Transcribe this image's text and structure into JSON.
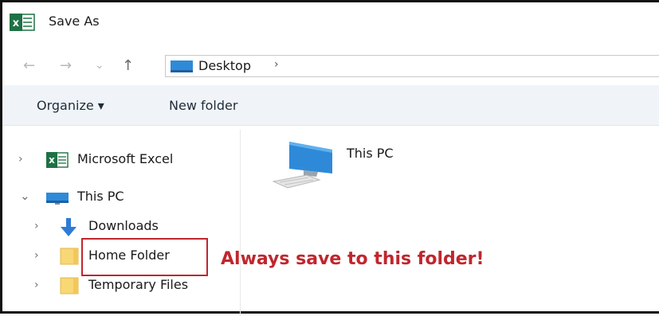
{
  "window": {
    "title": "Save As"
  },
  "navigation": {
    "back_glyph": "←",
    "forward_glyph": "→",
    "recent_glyph": "⌄",
    "up_glyph": "↑",
    "address_chevron": "›",
    "address_text": "Desktop"
  },
  "toolbar": {
    "organize_label": "Organize ▾",
    "new_folder_label": "New folder"
  },
  "sidebar": {
    "items": [
      {
        "label": "Microsoft Excel",
        "icon": "excel-icon",
        "expander": "›"
      },
      {
        "label": "This PC",
        "icon": "computer-icon",
        "expander": "⌄"
      },
      {
        "label": "Downloads",
        "icon": "downloads-arrow-icon",
        "expander": "›"
      },
      {
        "label": "Home Folder",
        "icon": "folder-icon",
        "expander": "›"
      },
      {
        "label": "Temporary Files",
        "icon": "folder-icon",
        "expander": "›"
      }
    ]
  },
  "content": {
    "items": [
      {
        "label": "This PC",
        "icon": "computer-icon"
      }
    ]
  },
  "annotation": {
    "text": "Always save to this folder!"
  },
  "colors": {
    "accent_red": "#c0262d",
    "excel_green": "#1e7145",
    "folder_yellow": "#f8d775",
    "monitor_blue": "#2e8ad8"
  }
}
